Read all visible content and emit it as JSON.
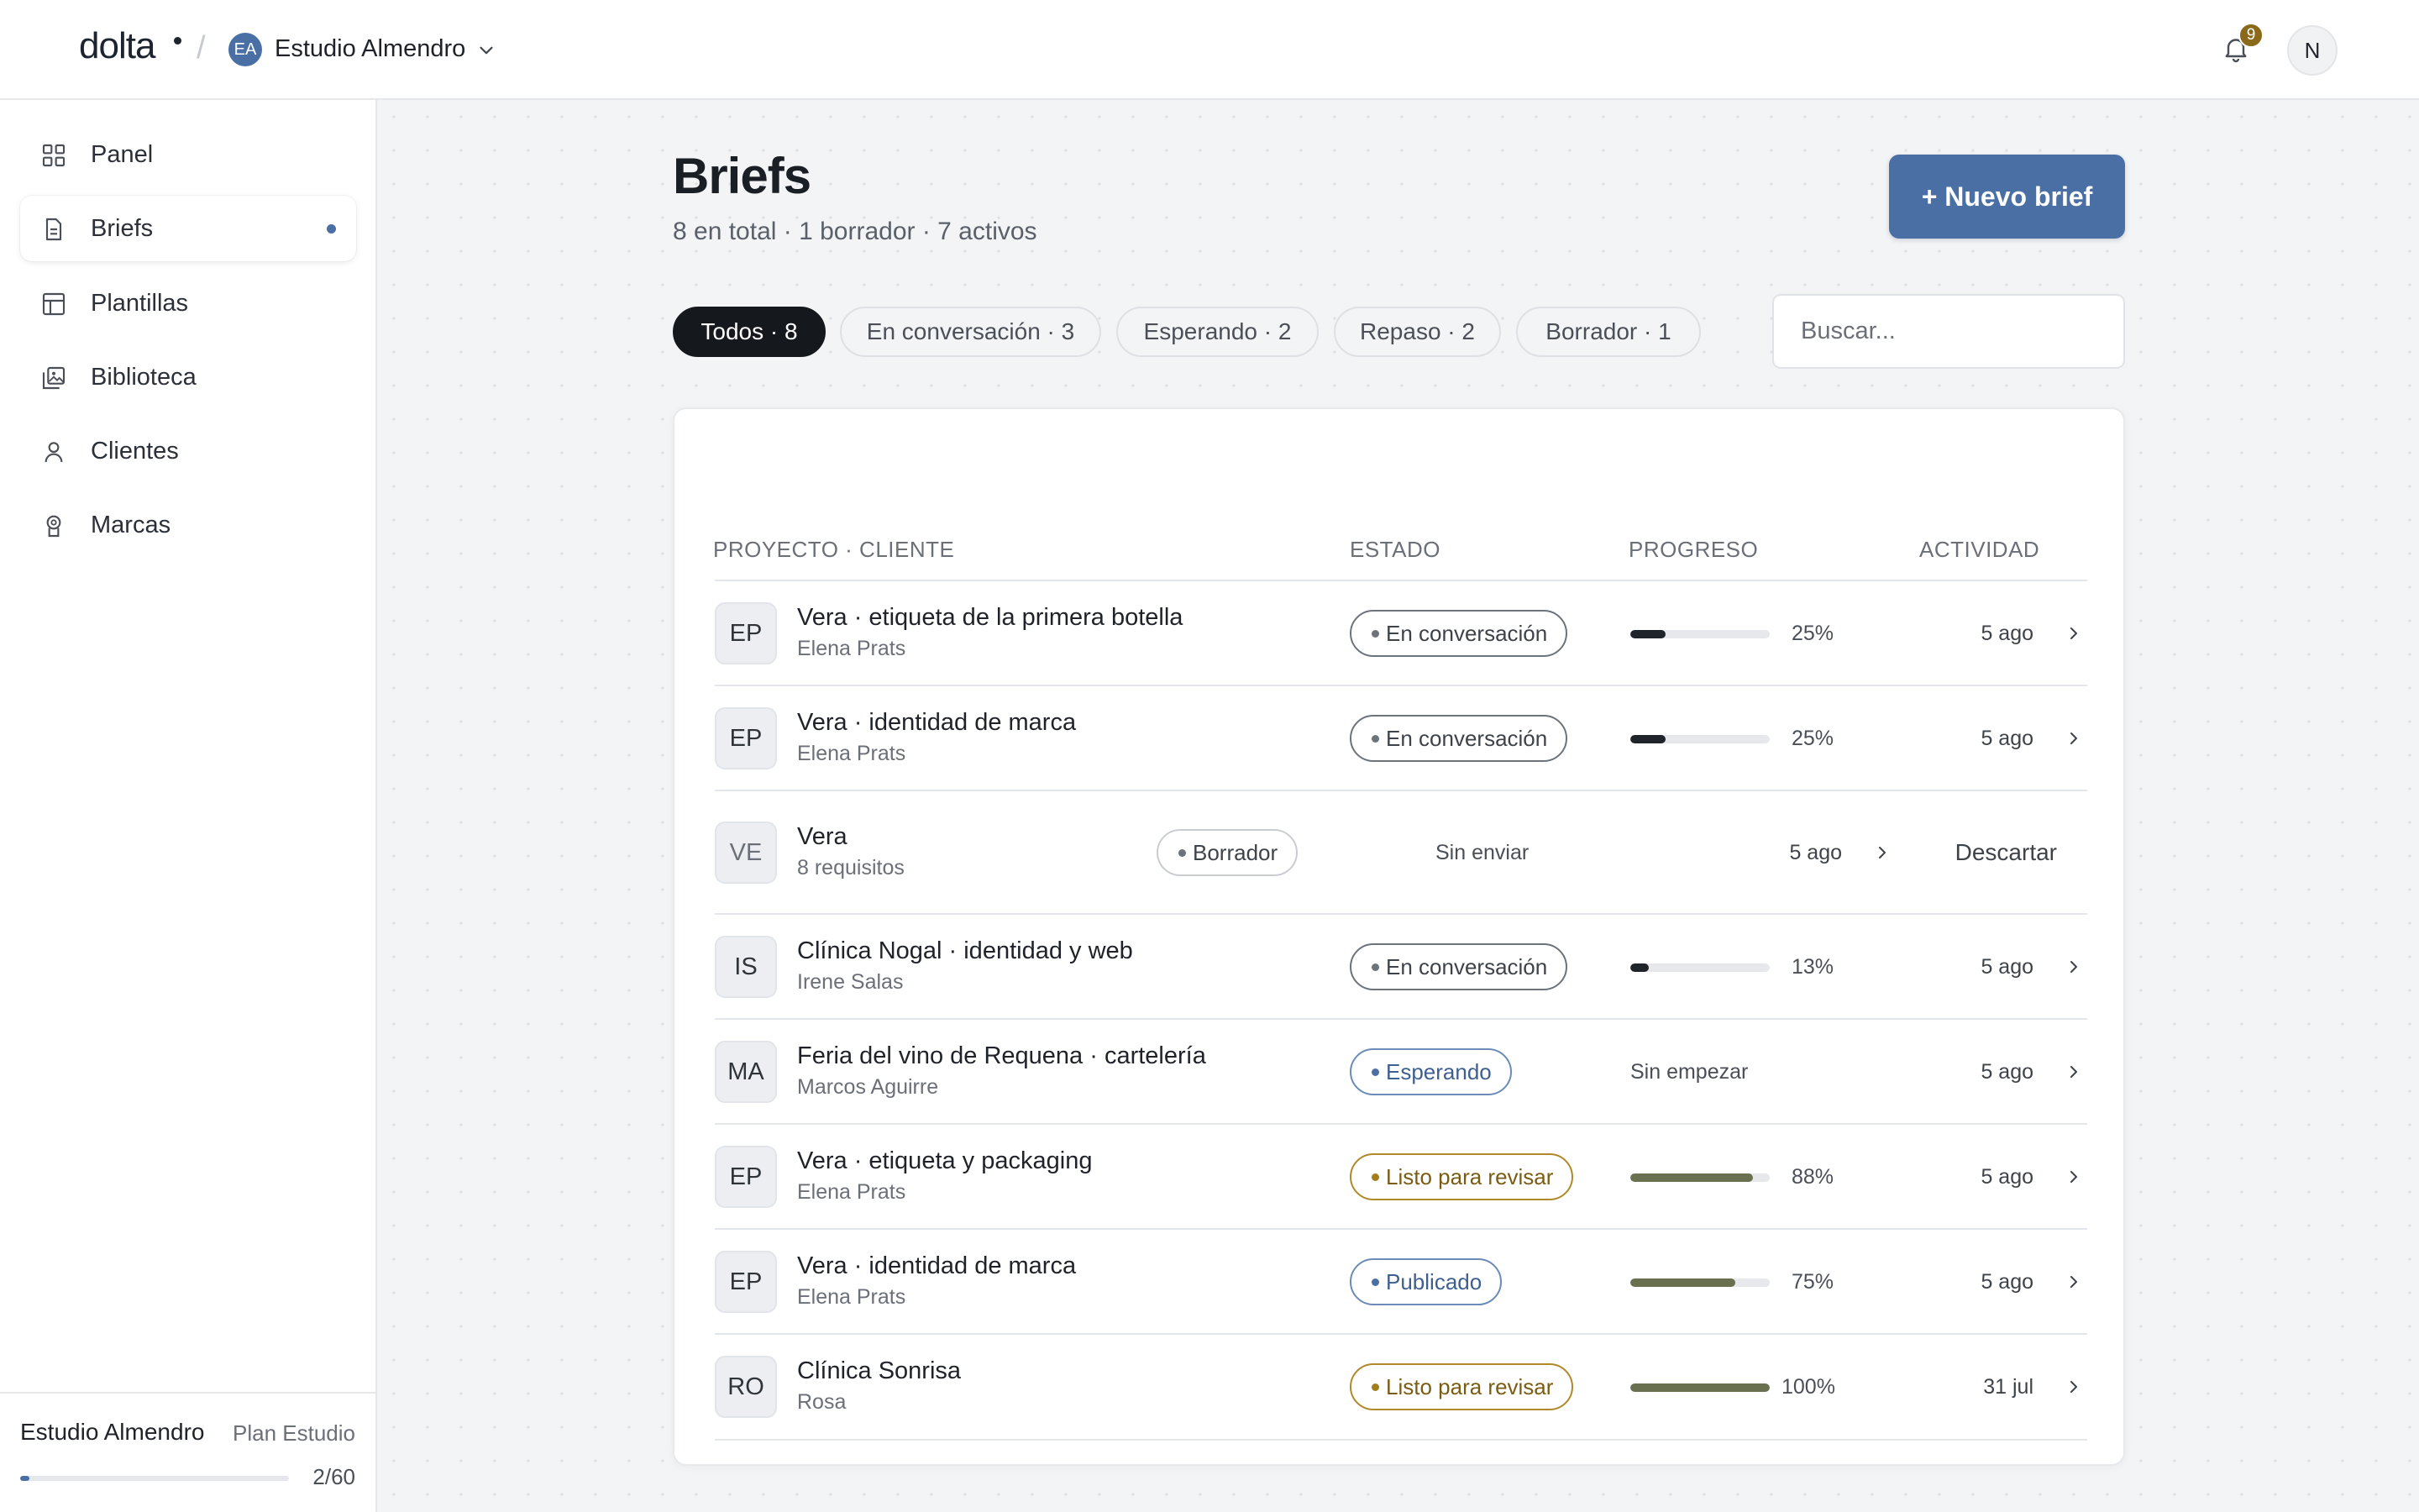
{
  "topbar": {
    "logo": "dolta",
    "separator": "/",
    "workspace_initials": "EA",
    "workspace_name": "Estudio Almendro",
    "notifications_count": "9",
    "user_initial": "N"
  },
  "sidebar": {
    "items": [
      {
        "label": "Panel",
        "icon": "grid-icon"
      },
      {
        "label": "Briefs",
        "icon": "document-icon",
        "active": true
      },
      {
        "label": "Plantillas",
        "icon": "template-icon"
      },
      {
        "label": "Biblioteca",
        "icon": "library-icon"
      },
      {
        "label": "Clientes",
        "icon": "person-icon"
      },
      {
        "label": "Marcas",
        "icon": "badge-icon"
      }
    ],
    "footer": {
      "studio": "Estudio Almendro",
      "plan": "Plan Estudio",
      "usage": "2/60",
      "usage_fraction": 0.033
    }
  },
  "main": {
    "title": "Briefs",
    "subtitle": "8 en total · 1 borrador · 7 activos",
    "new_button": "+ Nuevo brief",
    "filters": [
      {
        "label": "Todos · 8",
        "active": true
      },
      {
        "label": "En conversación · 3"
      },
      {
        "label": "Esperando · 2"
      },
      {
        "label": "Repaso · 2"
      },
      {
        "label": "Borrador · 1"
      }
    ],
    "search_placeholder": "Buscar..."
  },
  "table": {
    "headers": {
      "project": "PROYECTO · CLIENTE",
      "status": "ESTADO",
      "progress": "PROGRESO",
      "activity": "ACTIVIDAD"
    },
    "rows": [
      {
        "initials": "EP",
        "title": "Vera · etiqueta de la primera botella",
        "client": "Elena Prats",
        "status": "En conversación",
        "progress_pct": "25%",
        "progress": 0.25,
        "activity": "5 ago"
      },
      {
        "initials": "EP",
        "title": "Vera · identidad de marca",
        "client": "Elena Prats",
        "status": "En conversación",
        "progress_pct": "25%",
        "progress": 0.25,
        "activity": "5 ago"
      },
      {
        "initials": "VE",
        "title": "Vera",
        "client": "8 requisitos",
        "status": "Borrador",
        "progress_text": "Sin enviar",
        "activity": "5 ago",
        "action": "Descartar"
      },
      {
        "initials": "IS",
        "title": "Clínica Nogal · identidad y web",
        "client": "Irene Salas",
        "status": "En conversación",
        "progress_pct": "13%",
        "progress": 0.13,
        "activity": "5 ago"
      },
      {
        "initials": "MA",
        "title": "Feria del vino de Requena · cartelería",
        "client": "Marcos Aguirre",
        "status": "Esperando",
        "progress_text": "Sin empezar",
        "activity": "5 ago"
      },
      {
        "initials": "EP",
        "title": "Vera · etiqueta y packaging",
        "client": "Elena Prats",
        "status": "Listo para revisar",
        "progress_pct": "88%",
        "progress": 0.88,
        "activity": "5 ago"
      },
      {
        "initials": "EP",
        "title": "Vera · identidad de marca",
        "client": "Elena Prats",
        "status": "Publicado",
        "progress_pct": "75%",
        "progress": 0.75,
        "activity": "5 ago"
      },
      {
        "initials": "RO",
        "title": "Clínica Sonrisa",
        "client": "Rosa",
        "status": "Listo para revisar",
        "progress_pct": "100%",
        "progress": 1.0,
        "activity": "31 jul"
      }
    ]
  },
  "colors": {
    "accent": "#4a6fa5",
    "ink": "#15181c",
    "amber": "#a37d1c",
    "progress_green": "#69704f",
    "progress_dark": "#1f242b"
  }
}
